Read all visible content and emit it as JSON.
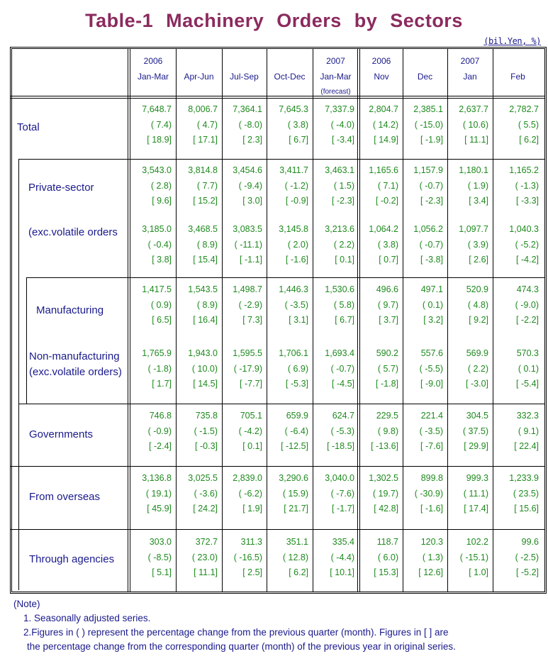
{
  "title": "Table-1  Machinery  Orders  by  Sectors",
  "unit": "(bil.Yen, %)",
  "columns": [
    {
      "line1": "2006",
      "line2": "Jan-Mar",
      "line3": ""
    },
    {
      "line1": "",
      "line2": "Apr-Jun",
      "line3": ""
    },
    {
      "line1": "",
      "line2": "Jul-Sep",
      "line3": ""
    },
    {
      "line1": "",
      "line2": "Oct-Dec",
      "line3": ""
    },
    {
      "line1": "2007",
      "line2": "Jan-Mar",
      "line3": "(forecast)"
    },
    {
      "line1": "2006",
      "line2": "Nov",
      "line3": ""
    },
    {
      "line1": "",
      "line2": "Dec",
      "line3": ""
    },
    {
      "line1": "2007",
      "line2": "Jan",
      "line3": ""
    },
    {
      "line1": "",
      "line2": "Feb",
      "line3": ""
    }
  ],
  "rows": [
    {
      "label": "Total",
      "label2": "",
      "values": [
        "7,648.7",
        "8,006.7",
        "7,364.1",
        "7,645.3",
        "7,337.9",
        "2,804.7",
        "2,385.1",
        "2,637.7",
        "2,782.7"
      ],
      "qoq": [
        "( 7.4)",
        "( 4.7)",
        "( -8.0)",
        "( 3.8)",
        "( -4.0)",
        "( 14.2)",
        "( -15.0)",
        "( 10.6)",
        "( 5.5)"
      ],
      "yoy": [
        "[ 18.9]",
        "[ 17.1]",
        "[ 2.3]",
        "[ 6.7]",
        "[ -3.4]",
        "[ 14.9]",
        "[ -1.9]",
        "[ 11.1]",
        "[ 6.2]"
      ]
    },
    {
      "label": "Private-sector",
      "label2": "",
      "values": [
        "3,543.0",
        "3,814.8",
        "3,454.6",
        "3,411.7",
        "3,463.1",
        "1,165.6",
        "1,157.9",
        "1,180.1",
        "1,165.2"
      ],
      "qoq": [
        "( 2.8)",
        "( 7.7)",
        "( -9.4)",
        "( -1.2)",
        "( 1.5)",
        "( 7.1)",
        "( -0.7)",
        "( 1.9)",
        "( -1.3)"
      ],
      "yoy": [
        "[ 9.6]",
        "[ 15.2]",
        "[ 3.0]",
        "[ -0.9]",
        "[ -2.3]",
        "[ -0.2]",
        "[ -2.3]",
        "[ 3.4]",
        "[ -3.3]"
      ]
    },
    {
      "label": "(exc.volatile orders",
      "label2": "",
      "values": [
        "3,185.0",
        "3,468.5",
        "3,083.5",
        "3,145.8",
        "3,213.6",
        "1,064.2",
        "1,056.2",
        "1,097.7",
        "1,040.3"
      ],
      "qoq": [
        "( -0.4)",
        "( 8.9)",
        "( -11.1)",
        "( 2.0)",
        "( 2.2)",
        "( 3.8)",
        "( -0.7)",
        "( 3.9)",
        "( -5.2)"
      ],
      "yoy": [
        "[ 3.8]",
        "[ 15.4]",
        "[ -1.1]",
        "[ -1.6]",
        "[ 0.1]",
        "[ 0.7]",
        "[ -3.8]",
        "[ 2.6]",
        "[ -4.2]"
      ]
    },
    {
      "label": "Manufacturing",
      "label2": "",
      "values": [
        "1,417.5",
        "1,543.5",
        "1,498.7",
        "1,446.3",
        "1,530.6",
        "496.6",
        "497.1",
        "520.9",
        "474.3"
      ],
      "qoq": [
        "( 0.9)",
        "( 8.9)",
        "( -2.9)",
        "( -3.5)",
        "( 5.8)",
        "( 9.7)",
        "( 0.1)",
        "( 4.8)",
        "( -9.0)"
      ],
      "yoy": [
        "[ 6.5]",
        "[ 16.4]",
        "[ 7.3]",
        "[ 3.1]",
        "[ 6.7]",
        "[ 3.7]",
        "[ 3.2]",
        "[ 9.2]",
        "[ -2.2]"
      ]
    },
    {
      "label": "Non-manufacturing",
      "label2": "(exc.volatile orders)",
      "values": [
        "1,765.9",
        "1,943.0",
        "1,595.5",
        "1,706.1",
        "1,693.4",
        "590.2",
        "557.6",
        "569.9",
        "570.3"
      ],
      "qoq": [
        "( -1.8)",
        "( 10.0)",
        "( -17.9)",
        "( 6.9)",
        "( -0.7)",
        "( 5.7)",
        "( -5.5)",
        "( 2.2)",
        "( 0.1)"
      ],
      "yoy": [
        "[ 1.7]",
        "[ 14.5]",
        "[ -7.7]",
        "[ -5.3]",
        "[ -4.5]",
        "[ -1.8]",
        "[ -9.0]",
        "[ -3.0]",
        "[ -5.4]"
      ]
    },
    {
      "label": "Governments",
      "label2": "",
      "values": [
        "746.8",
        "735.8",
        "705.1",
        "659.9",
        "624.7",
        "229.5",
        "221.4",
        "304.5",
        "332.3"
      ],
      "qoq": [
        "( -0.9)",
        "( -1.5)",
        "( -4.2)",
        "( -6.4)",
        "( -5.3)",
        "( 9.8)",
        "( -3.5)",
        "( 37.5)",
        "( 9.1)"
      ],
      "yoy": [
        "[ -2.4]",
        "[ -0.3]",
        "[ 0.1]",
        "[ -12.5]",
        "[ -18.5]",
        "[ -13.6]",
        "[ -7.6]",
        "[ 29.9]",
        "[ 22.4]"
      ]
    },
    {
      "label": "From overseas",
      "label2": "",
      "values": [
        "3,136.8",
        "3,025.5",
        "2,839.0",
        "3,290.6",
        "3,040.0",
        "1,302.5",
        "899.8",
        "999.3",
        "1,233.9"
      ],
      "qoq": [
        "( 19.1)",
        "( -3.6)",
        "( -6.2)",
        "( 15.9)",
        "( -7.6)",
        "( 19.7)",
        "( -30.9)",
        "( 11.1)",
        "( 23.5)"
      ],
      "yoy": [
        "[ 45.9]",
        "[ 24.2]",
        "[ 1.9]",
        "[ 21.7]",
        "[ -1.7]",
        "[ 42.8]",
        "[ -1.6]",
        "[ 17.4]",
        "[ 15.6]"
      ]
    },
    {
      "label": "Through agencies",
      "label2": "",
      "values": [
        "303.0",
        "372.7",
        "311.3",
        "351.1",
        "335.4",
        "118.7",
        "120.3",
        "102.2",
        "99.6"
      ],
      "qoq": [
        "( -8.5)",
        "( 23.0)",
        "( -16.5)",
        "( 12.8)",
        "( -4.4)",
        "( 6.0)",
        "( 1.3)",
        "( -15.1)",
        "( -2.5)"
      ],
      "yoy": [
        "[ 5.1]",
        "[ 11.1]",
        "[ 2.5]",
        "[ 6.2]",
        "[ 10.1]",
        "[ 15.3]",
        "[ 12.6]",
        "[ 1.0]",
        "[ -5.2]"
      ]
    }
  ],
  "notes": {
    "heading": "(Note)",
    "line1": "1. Seasonally adjusted series.",
    "line2": "2.Figures in ( ) represent the percentage change from the previous quarter (month). Figures in [ ] are",
    "line3": "the percentage change from the corresponding quarter (month) of the previous year in original series."
  }
}
